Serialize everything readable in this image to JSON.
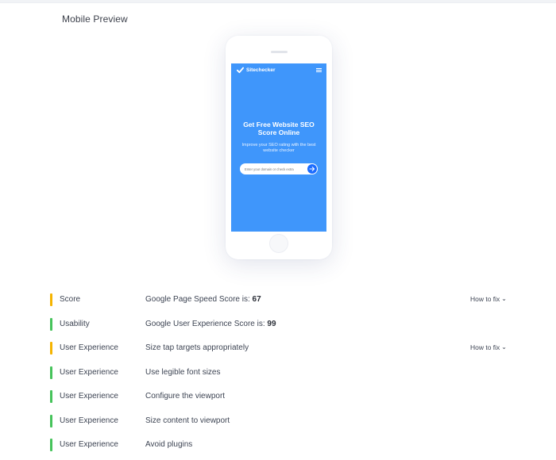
{
  "section": {
    "title": "Mobile Preview"
  },
  "preview": {
    "brand": "Sitechecker",
    "headline": "Get Free Website SEO Score Online",
    "subheadline": "Improve your SEO rating with the best website checker",
    "domain_placeholder": "Enter your domain or check extra",
    "screen_color": "#3f96fb",
    "button_color": "#1b6cff"
  },
  "rows": [
    {
      "category": "Score",
      "description": "Google Page Speed Score is: ",
      "value": "67",
      "status": "warning",
      "fix_label": "How to fix"
    },
    {
      "category": "Usability",
      "description": "Google User Experience Score is: ",
      "value": "99",
      "status": "ok",
      "fix_label": ""
    },
    {
      "category": "User Experience",
      "description": "Size tap targets appropriately",
      "value": "",
      "status": "warning",
      "fix_label": "How to fix"
    },
    {
      "category": "User Experience",
      "description": "Use legible font sizes",
      "value": "",
      "status": "ok",
      "fix_label": ""
    },
    {
      "category": "User Experience",
      "description": "Configure the viewport",
      "value": "",
      "status": "ok",
      "fix_label": ""
    },
    {
      "category": "User Experience",
      "description": "Size content to viewport",
      "value": "",
      "status": "ok",
      "fix_label": ""
    },
    {
      "category": "User Experience",
      "description": "Avoid plugins",
      "value": "",
      "status": "ok",
      "fix_label": ""
    }
  ],
  "colors": {
    "warning": "#f5b400",
    "ok": "#46c35b"
  },
  "icons": {
    "fix_toggle": "chevron-down-icon",
    "brand": "checkmark-logo-icon",
    "menu": "hamburger-menu-icon",
    "submit": "arrow-right-icon"
  }
}
